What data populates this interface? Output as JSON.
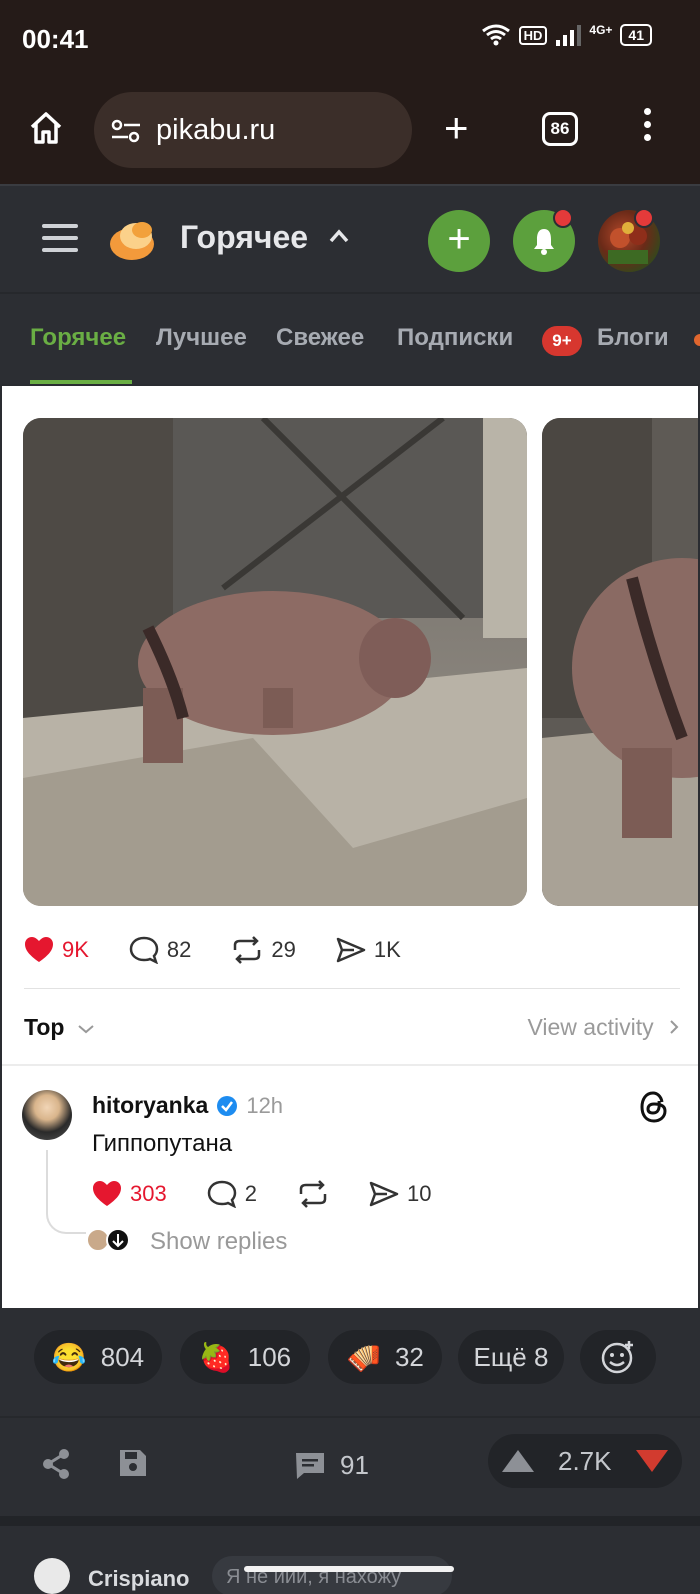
{
  "status_bar": {
    "time": "00:41",
    "hd": "HD",
    "network": "4G+",
    "battery": "41"
  },
  "browser": {
    "url": "pikabu.ru",
    "tab_count": "86",
    "icons": [
      "home-icon",
      "site-settings-icon",
      "new-tab-icon",
      "tabs-icon",
      "menu-icon"
    ]
  },
  "header": {
    "title": "Горячее",
    "accent": "#5ca03d"
  },
  "category_tabs": {
    "items": [
      "Горячее",
      "Лучшее",
      "Свежее",
      "Подписки",
      "Блоги"
    ],
    "subscriptions_badge": "9+",
    "active": "Горячее"
  },
  "embed": {
    "stats": {
      "likes": "9K",
      "comments": "82",
      "reposts": "29",
      "shares": "1K"
    },
    "sort_label": "Top",
    "view_activity": "View activity",
    "comment": {
      "username": "hitoryanka",
      "time": "12h",
      "text": "Гиппопутана",
      "likes": "303",
      "replies": "2",
      "shares": "10",
      "show_replies": "Show replies"
    }
  },
  "reactions": [
    {
      "emoji": "😂",
      "count": "804"
    },
    {
      "emoji": "🍓",
      "count": "106"
    },
    {
      "emoji": "🪗",
      "count": "32"
    }
  ],
  "reactions_more": "Ещё 8",
  "actions": {
    "comments_count": "91",
    "rating": "2.7K"
  },
  "next_post": {
    "author": "Crispiano",
    "snippet": "Я не иии, я нахожу"
  }
}
